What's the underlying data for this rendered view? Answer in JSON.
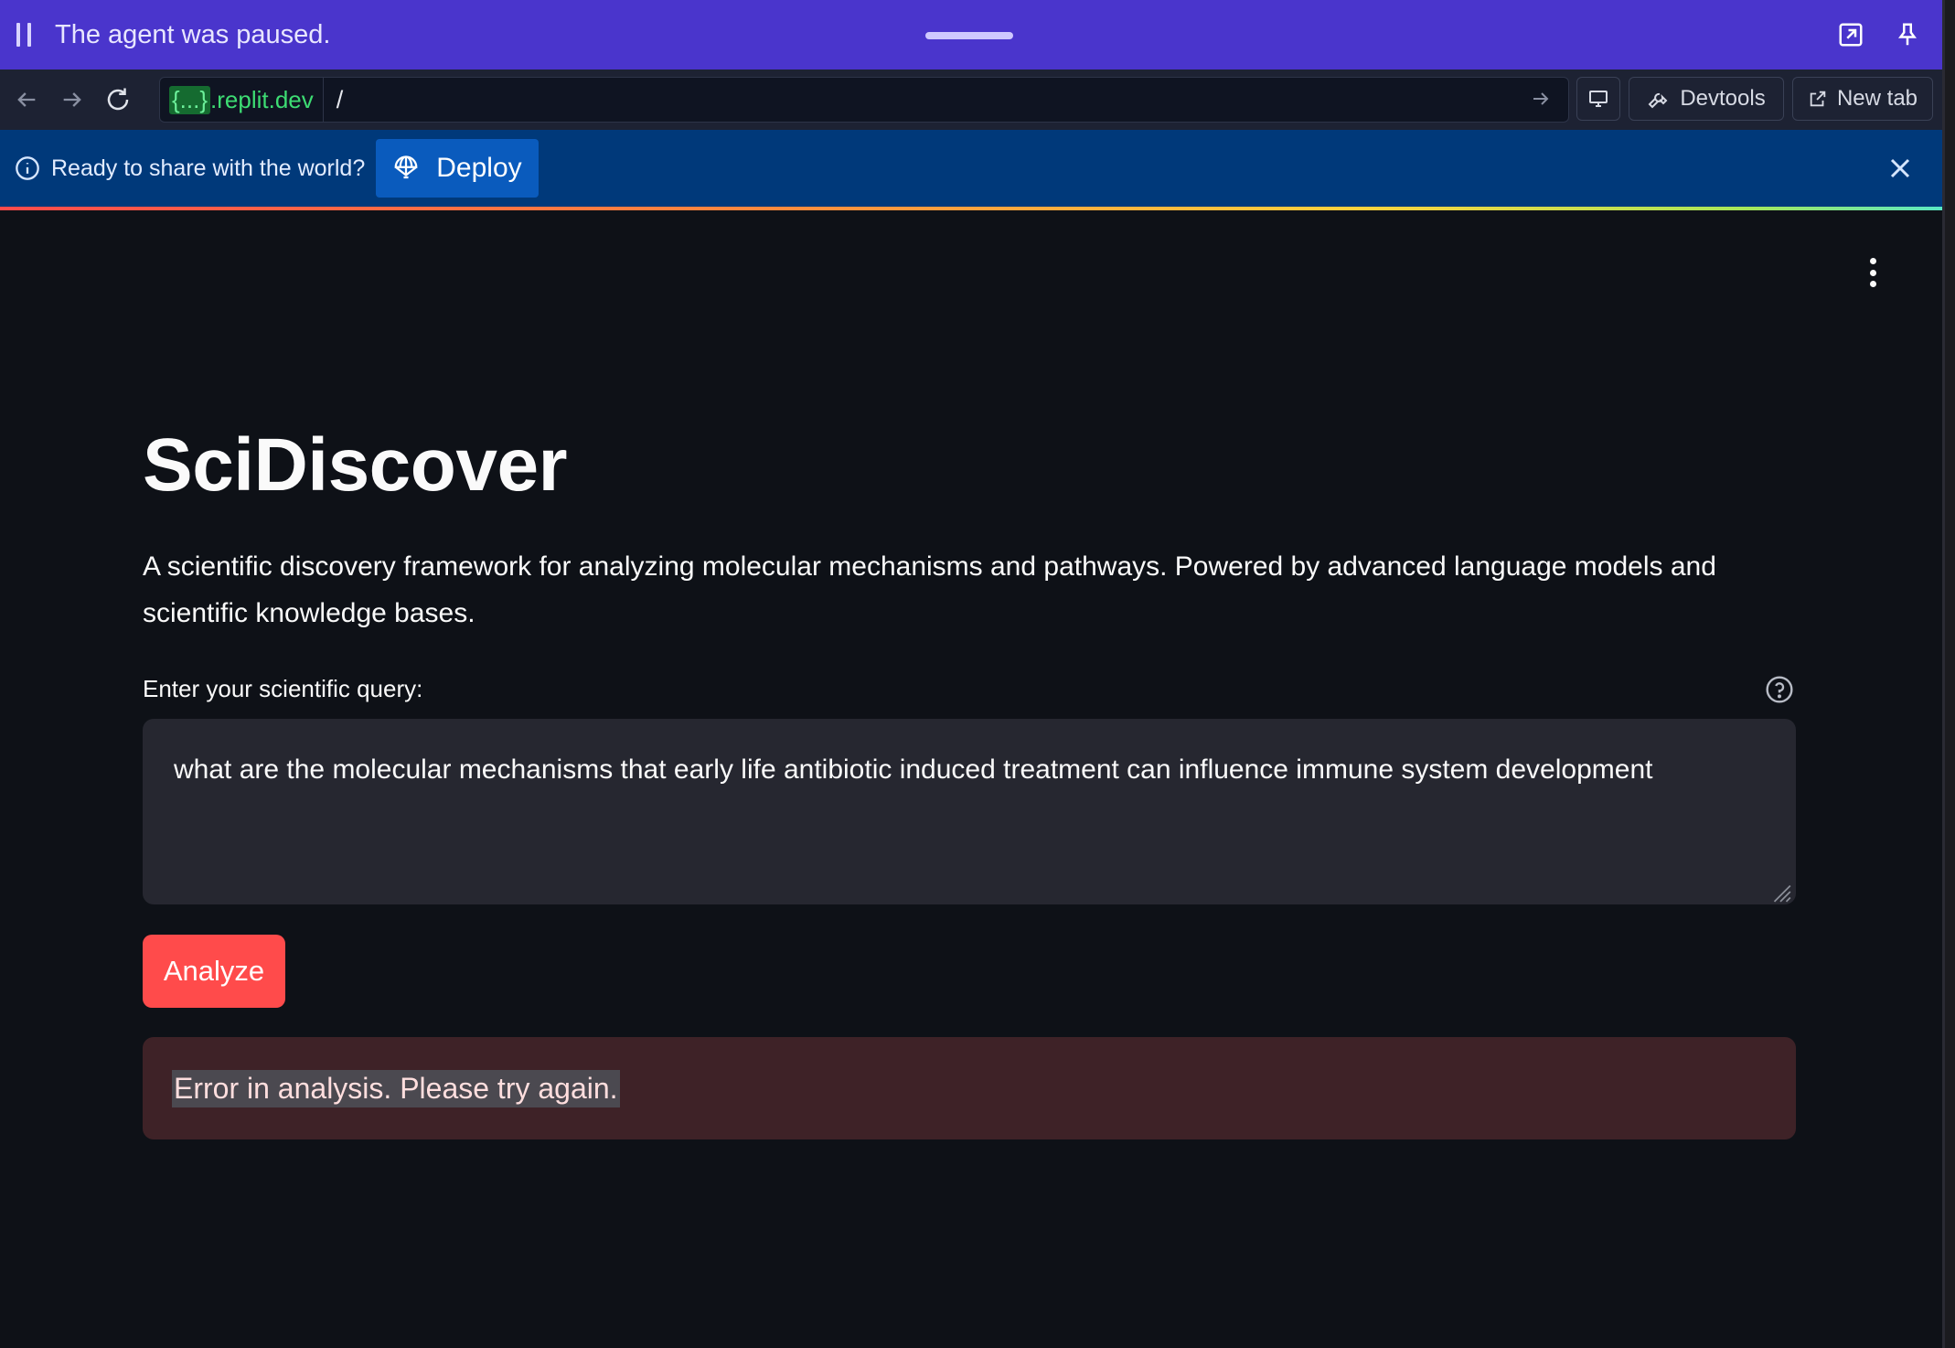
{
  "agent_bar": {
    "status_text": "The agent was paused.",
    "icons": [
      "pause-icon",
      "open-external-icon",
      "pin-icon"
    ]
  },
  "browser_bar": {
    "host_brace": "{...}",
    "host_domain": ".replit.dev",
    "path": "/",
    "devtools_label": "Devtools",
    "new_tab_label": "New tab"
  },
  "deploy_bar": {
    "message": "Ready to share with the world?",
    "deploy_label": "Deploy",
    "accent_color": "#00397a"
  },
  "app": {
    "title": "SciDiscover",
    "description": "A scientific discovery framework for analyzing molecular mechanisms and pathways. Powered by advanced language models and scientific knowledge bases.",
    "query_label": "Enter your scientific query:",
    "query_value": "what are the molecular mechanisms that early life antibiotic induced treatment can influence immune system development",
    "analyze_label": "Analyze",
    "error_message": "Error in analysis. Please try again.",
    "primary_color": "#ff4b4b",
    "background_color": "#0e1117"
  }
}
